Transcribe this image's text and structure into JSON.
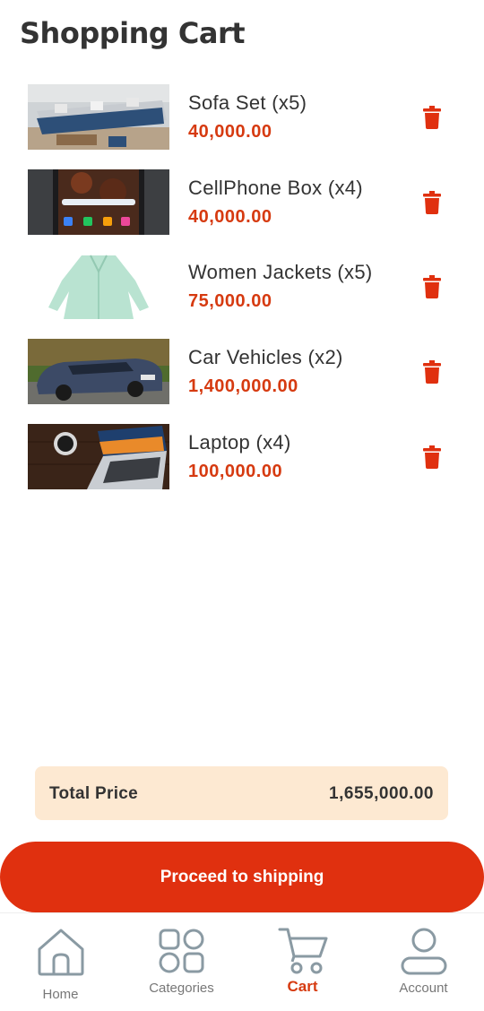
{
  "header": {
    "title": "Shopping Cart"
  },
  "cart": {
    "items": [
      {
        "name": "Sofa Set (x5)",
        "price": "40,000.00",
        "image": "sofa-set-image"
      },
      {
        "name": "CellPhone Box (x4)",
        "price": "40,000.00",
        "image": "cellphone-image"
      },
      {
        "name": "Women Jackets (x5)",
        "price": "75,000.00",
        "image": "women-jacket-image"
      },
      {
        "name": "Car Vehicles (x2)",
        "price": "1,400,000.00",
        "image": "car-image"
      },
      {
        "name": "Laptop (x4)",
        "price": "100,000.00",
        "image": "laptop-image"
      }
    ],
    "delete_icon": "trash-icon"
  },
  "summary": {
    "total_label": "Total Price",
    "total_value": "1,655,000.00"
  },
  "actions": {
    "proceed_label": "Proceed to shipping"
  },
  "nav": {
    "items": [
      {
        "label": "Home",
        "icon": "home-icon"
      },
      {
        "label": "Categories",
        "icon": "categories-icon"
      },
      {
        "label": "Cart",
        "icon": "cart-icon",
        "active": true
      },
      {
        "label": "Account",
        "icon": "account-icon"
      }
    ]
  },
  "colors": {
    "accent": "#e0300f",
    "price": "#d63a10",
    "summary_bg": "#fde9d2",
    "nav_inactive": "#8a9aa3"
  }
}
